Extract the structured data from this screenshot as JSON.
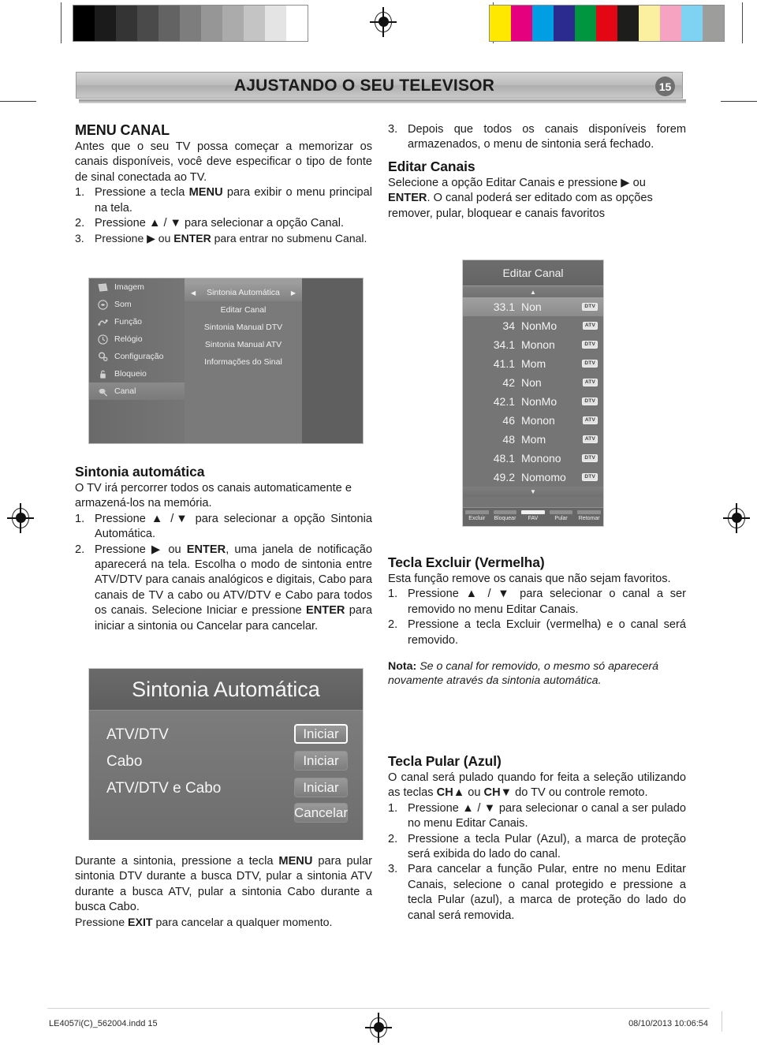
{
  "header": {
    "title": "AJUSTANDO O SEU TELEVISOR",
    "page_number": "15",
    "badge_color": "#6f6f6f"
  },
  "left_column": {
    "menu_canal": {
      "heading": "MENU CANAL",
      "intro": "Antes que o seu TV possa começar a memorizar os canais disponíveis, você deve especificar o tipo de fonte de sinal conectada ao TV.",
      "steps": [
        {
          "num": "1.",
          "text": "Pressione a tecla MENU para exibir o menu principal na tela."
        },
        {
          "num": "2.",
          "text": "Pressione ▲ / ▼ para selecionar a opção Canal."
        },
        {
          "num": "3.",
          "text": "Pressione ▶ ou ENTER para entrar no submenu Canal."
        }
      ]
    },
    "sintonia_automatica": {
      "heading": "Sintonia automática",
      "intro": "O TV irá percorrer todos os canais automaticamente e armazená-los na memória.",
      "steps": [
        {
          "num": "1.",
          "text": "Pressione ▲ /▼ para selecionar a opção Sintonia Automática."
        },
        {
          "num": "2.",
          "text": "Pressione ▶ ou ENTER, uma janela de notificação aparecerá na tela. Escolha o modo de sintonia entre ATV/DTV para canais analógicos e digitais, Cabo para canais de TV a cabo ou ATV/DTV e Cabo para todos os canais. Selecione Iniciar e pressione ENTER para iniciar a sintonia ou Cancelar para cancelar."
        }
      ]
    },
    "closing": {
      "paragraph": "Durante a sintonia, pressione a tecla MENU para pular  sintonia DTV durante a busca DTV, pular a sintonia ATV durante a busca ATV, pular a sintonia Cabo durante a busca Cabo.",
      "exit_line": "Pressione EXIT para cancelar a qualquer momento."
    }
  },
  "right_column": {
    "step3": {
      "num": "3.",
      "text": "Depois que todos os canais disponíveis forem armazenados, o menu de sintonia será fechado."
    },
    "editar_canais": {
      "heading": "Editar Canais",
      "body": "Selecione a opção Editar Canais e pressione ▶ ou ENTER. O canal poderá ser editado com as opções remover, pular, bloquear e canais favoritos"
    },
    "tecla_excluir": {
      "heading": "Tecla Excluir (Vermelha)",
      "intro": "Esta função remove os canais que não sejam favoritos.",
      "steps": [
        {
          "num": "1.",
          "text": "Pressione ▲ / ▼ para selecionar o canal a ser removido no menu Editar Canais."
        },
        {
          "num": "2.",
          "text": "Pressione a tecla Excluir (vermelha) e o canal será removido."
        }
      ],
      "note_label": "Nota:",
      "note_text": " Se o canal for removido, o mesmo só aparecerá novamente através da sintonia automática."
    },
    "tecla_pular": {
      "heading": "Tecla Pular (Azul)",
      "intro": "O canal será pulado quando for feita a seleção utilizando as teclas CH▲ ou CH▼ do TV ou controle remoto.",
      "steps": [
        {
          "num": "1.",
          "text": "Pressione ▲ / ▼ para selecionar o canal a ser pulado no menu Editar Canais."
        },
        {
          "num": "2.",
          "text": "Pressione a tecla Pular (Azul), a marca de proteção será exibida do lado do canal."
        },
        {
          "num": "3.",
          "text": "Para cancelar a função Pular, entre no menu Editar Canais, selecione o canal protegido e pressione a tecla Pular (azul), a marca de proteção do lado do canal será removida."
        }
      ]
    }
  },
  "osd_main_menu": {
    "sidebar": [
      {
        "label": "Imagem",
        "icon": "picture-icon",
        "selected": false
      },
      {
        "label": "Som",
        "icon": "sound-icon",
        "selected": false
      },
      {
        "label": "Função",
        "icon": "function-icon",
        "selected": false
      },
      {
        "label": "Relógio",
        "icon": "clock-icon",
        "selected": false
      },
      {
        "label": "Configuração",
        "icon": "settings-icon",
        "selected": false
      },
      {
        "label": "Bloqueio",
        "icon": "lock-icon",
        "selected": false
      },
      {
        "label": "Canal",
        "icon": "antenna-icon",
        "selected": true
      }
    ],
    "submenu": [
      {
        "label": "Sintonia Automática",
        "selected": true
      },
      {
        "label": "Editar Canal",
        "selected": false
      },
      {
        "label": "Sintonia Manual DTV",
        "selected": false
      },
      {
        "label": "Sintonia Manual ATV",
        "selected": false
      },
      {
        "label": "Informações do Sinal",
        "selected": false
      }
    ],
    "arrow_left": "◀",
    "arrow_right": "▶"
  },
  "osd_edit_channel": {
    "title": "Editar Canal",
    "scroll_up": "▲",
    "scroll_down": "▼",
    "channels": [
      {
        "number": "33.1",
        "name": "Non",
        "tag": "DTV",
        "selected": true
      },
      {
        "number": "34",
        "name": "NonMo",
        "tag": "ATV",
        "selected": false
      },
      {
        "number": "34.1",
        "name": "Monon",
        "tag": "DTV",
        "selected": false
      },
      {
        "number": "41.1",
        "name": "Mom",
        "tag": "DTV",
        "selected": false
      },
      {
        "number": "42",
        "name": "Non",
        "tag": "ATV",
        "selected": false
      },
      {
        "number": "42.1",
        "name": "NonMo",
        "tag": "DTV",
        "selected": false
      },
      {
        "number": "46",
        "name": "Monon",
        "tag": "ATV",
        "selected": false
      },
      {
        "number": "48",
        "name": "Mom",
        "tag": "ATV",
        "selected": false
      },
      {
        "number": "48.1",
        "name": "Monono",
        "tag": "DTV",
        "selected": false
      },
      {
        "number": "49.2",
        "name": "Nomomo",
        "tag": "DTV",
        "selected": false
      }
    ],
    "color_keys": [
      {
        "label": "Excluir",
        "bar": "#8f8f8f"
      },
      {
        "label": "Bloquear",
        "bar": "#8f8f8f"
      },
      {
        "label": "FAV",
        "bar": "#efefef"
      },
      {
        "label": "Pular",
        "bar": "#8f8f8f"
      },
      {
        "label": "Retomar",
        "bar": "#8f8f8f"
      }
    ]
  },
  "osd_autotune_dialog": {
    "title": "Sintonia Automática",
    "rows": [
      {
        "label": "ATV/DTV",
        "button": "Iniciar",
        "selected": true
      },
      {
        "label": "Cabo",
        "button": "Iniciar",
        "selected": false
      },
      {
        "label": "ATV/DTV e Cabo",
        "button": "Iniciar",
        "selected": false
      }
    ],
    "cancel_button": "Cancelar"
  },
  "footer": {
    "file": "LE4057i(C)_562004.indd   15",
    "timestamp": "08/10/2013   10:06:54"
  },
  "calibration": {
    "gray_swatches": [
      "#000000",
      "#1b1b1b",
      "#343434",
      "#4a4a4a",
      "#636363",
      "#7d7d7d",
      "#969696",
      "#ababab",
      "#c4c4c4",
      "#e4e4e4",
      "#ffffff"
    ],
    "color_swatches": [
      "#ffe800",
      "#e5007d",
      "#009fe3",
      "#2b2b8f",
      "#009640",
      "#e30613",
      "#1d1d1b",
      "#fbefa0",
      "#f5a3c0",
      "#7fd3f2",
      "#9d9d9c"
    ]
  }
}
